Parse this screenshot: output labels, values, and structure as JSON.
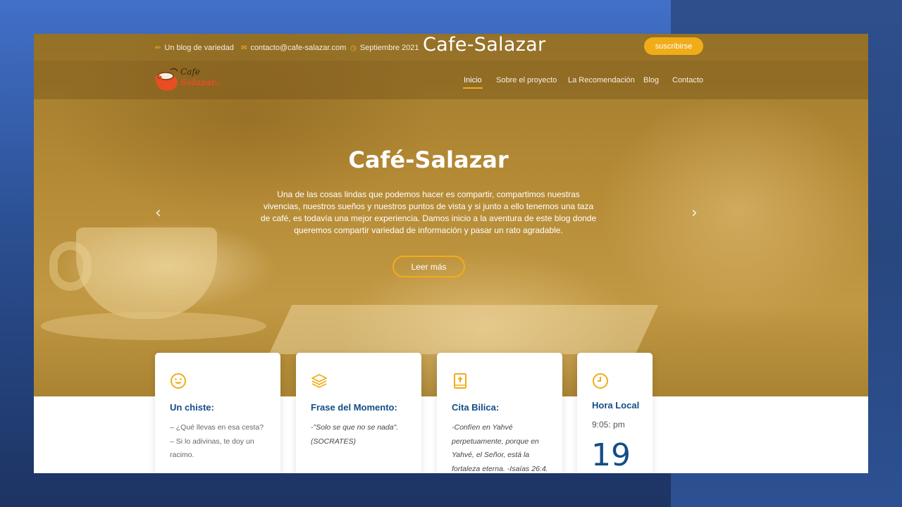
{
  "topbar": {
    "tagline": "Un blog de variedad",
    "email": "contacto@cafe-salazar.com",
    "date": "Septiembre 2021",
    "site_title": "Cafe-Salazar",
    "subscribe_label": "suscribirse"
  },
  "logo": {
    "line1": "Cafe",
    "line2": "Salazar",
    "suffix": ".com"
  },
  "nav": {
    "items": [
      {
        "label": "Inicio",
        "active": true
      },
      {
        "label": "Sobre el proyecto",
        "active": false
      },
      {
        "label": "La Recomendación",
        "active": false
      },
      {
        "label": "Blog",
        "active": false
      },
      {
        "label": "Contacto",
        "active": false
      }
    ]
  },
  "hero": {
    "title": "Café-Salazar",
    "lines": [
      "Una de las cosas lindas que podemos hacer es compartir, compartimos nuestras",
      "vivencias, nuestros sueños y nuestros puntos de vista y si junto a ello tenemos una taza",
      "de café, es todavía una mejor experiencia. Damos inicio a la aventura de este blog donde",
      "queremos compartir variedad de información y pasar un rato agradable."
    ],
    "button_label": "Leer más",
    "prev_icon": "chevron-left-icon",
    "next_icon": "chevron-right-icon"
  },
  "cards": [
    {
      "icon": "smiley-icon",
      "title": "Un chiste:",
      "lines": [
        "– ¿Qué llevas en esa cesta?",
        "– Si lo adivinas, te doy un",
        "racimo."
      ]
    },
    {
      "icon": "layers-icon",
      "title": "Frase del Momento:",
      "lines": [
        "-\"Solo se que no se nada\".",
        "(SOCRATES)"
      ]
    },
    {
      "icon": "bible-icon",
      "title": "Cita Bilica:",
      "lines": [
        "-Confíen en Yahvé",
        "perpetuamente, porque en",
        "Yahvé, el Señor, está la",
        "fortaleza eterna. -Isaías 26:4."
      ]
    },
    {
      "icon": "clock-icon",
      "title": "Hora Local",
      "time": "9:05: pm",
      "day": "19"
    }
  ],
  "colors": {
    "accent": "#f1ac1a",
    "card_title": "#134d86",
    "slide_bg": "#2b4f92"
  }
}
